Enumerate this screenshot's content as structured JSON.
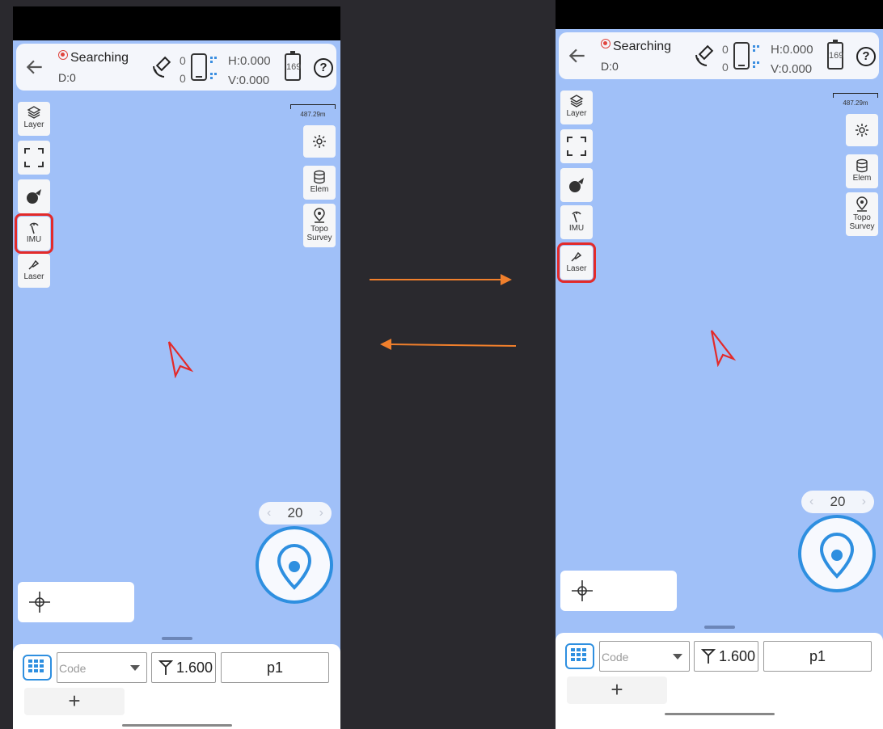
{
  "screens": [
    {
      "status": "Searching",
      "d_label": "D:0",
      "sat_count_top": "0",
      "sat_count_bottom": "0",
      "h_value": "H:0.000",
      "v_value": "V:0.000",
      "battery": "169",
      "help": "?",
      "tools": {
        "layer": "Layer",
        "imu": "IMU",
        "laser": "Laser"
      },
      "highlighted_tool": "IMU",
      "scale": "487.29m",
      "right_tools": {
        "elem": "Elem",
        "topo": "Topo Survey"
      },
      "zoom_value": "20",
      "code_placeholder": "Code",
      "antenna_height": "1.600",
      "point_name": "p1",
      "add": "+"
    },
    {
      "status": "Searching",
      "d_label": "D:0",
      "sat_count_top": "0",
      "sat_count_bottom": "0",
      "h_value": "H:0.000",
      "v_value": "V:0.000",
      "battery": "169",
      "help": "?",
      "tools": {
        "layer": "Layer",
        "imu": "IMU",
        "laser": "Laser"
      },
      "highlighted_tool": "Laser",
      "scale": "487.29m",
      "right_tools": {
        "elem": "Elem",
        "topo": "Topo Survey"
      },
      "zoom_value": "20",
      "code_placeholder": "Code",
      "antenna_height": "1.600",
      "point_name": "p1",
      "add": "+"
    }
  ],
  "colors": {
    "map": "#a0c0f8",
    "accent": "#2e8fe0",
    "highlight": "#e32a2a",
    "arrow": "#f07f2c",
    "background": "#2a292e",
    "cursor": "#e32a2a"
  },
  "icons": [
    "back-arrow-icon",
    "satellite-icon",
    "device-icon",
    "battery-icon",
    "help-icon",
    "layer-icon",
    "fullscreen-icon",
    "compass-icon",
    "imu-icon",
    "laser-icon",
    "settings-icon",
    "elem-icon",
    "topo-survey-icon",
    "locate-icon",
    "crosshair-icon",
    "grid-icon",
    "antenna-icon",
    "arrow-right-icon",
    "arrow-left-icon"
  ]
}
